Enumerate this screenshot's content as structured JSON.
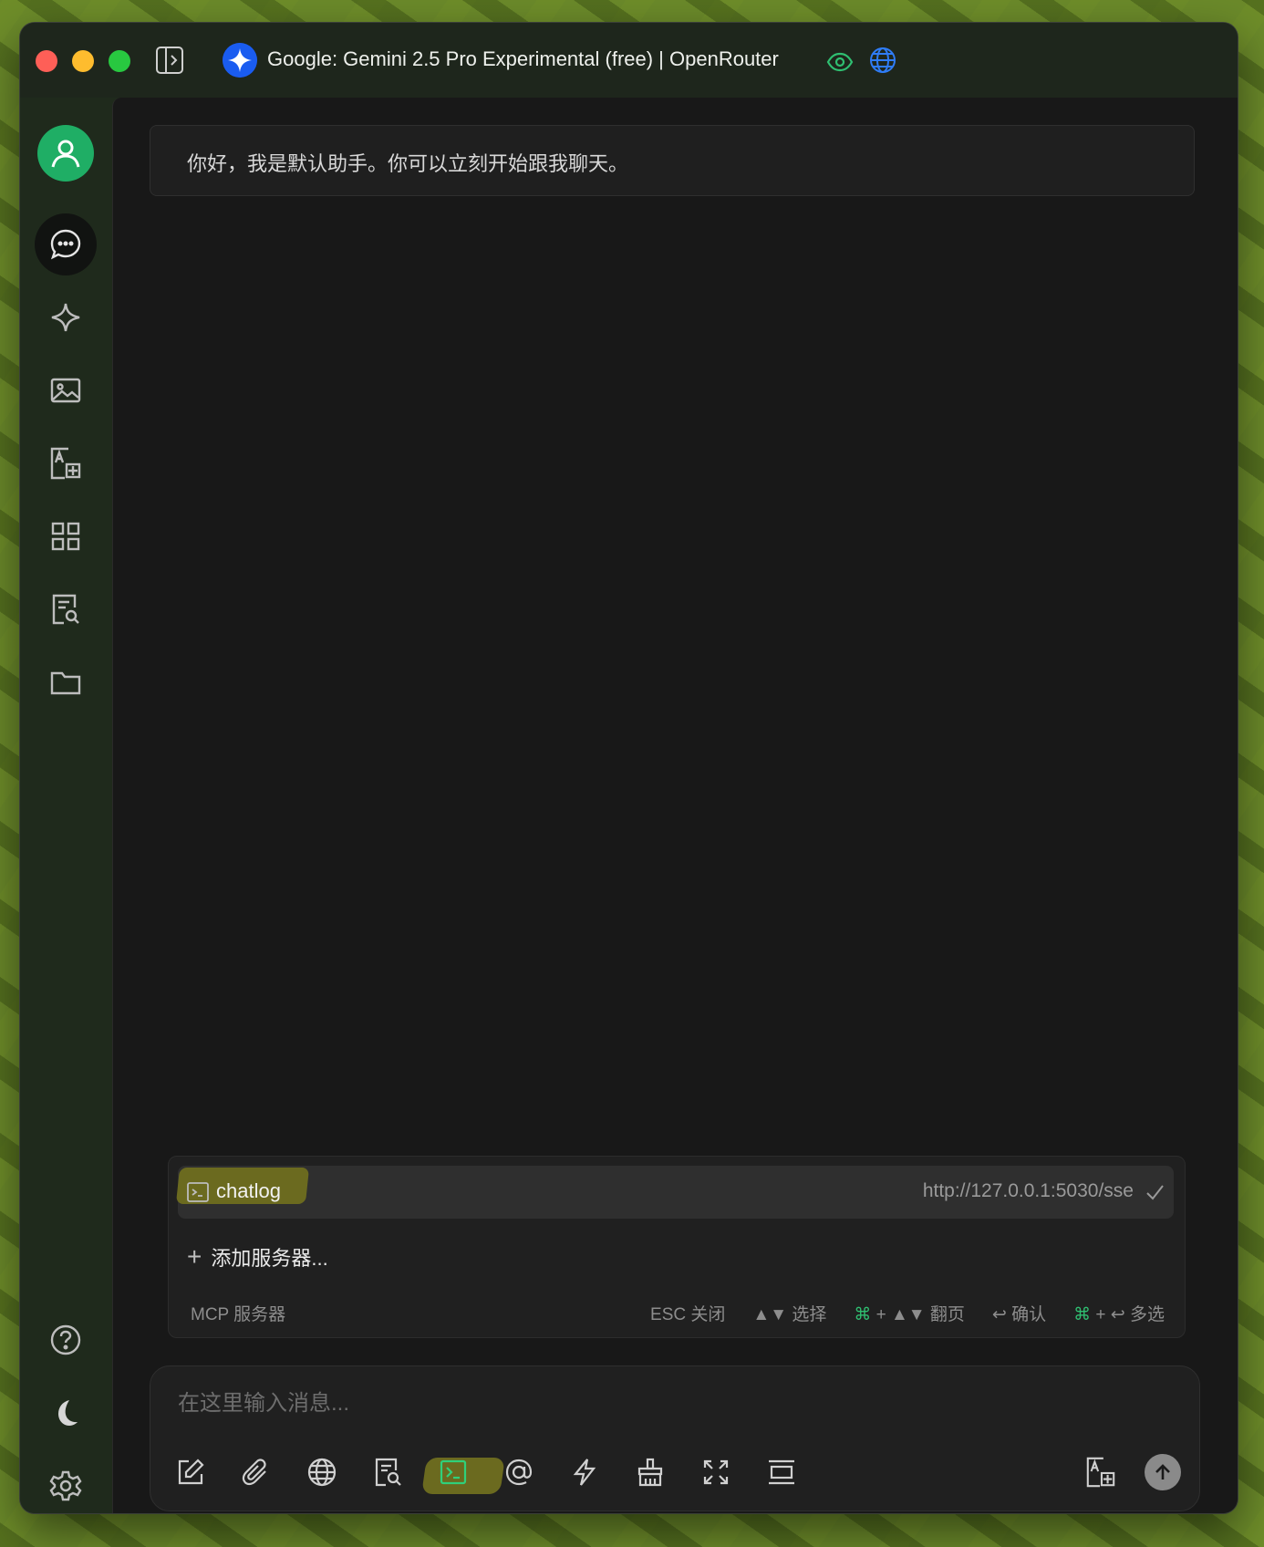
{
  "window": {
    "title": "Google: Gemini 2.5 Pro Experimental (free) | OpenRouter",
    "icons": [
      "sidebar-toggle-icon",
      "gemini-logo-icon",
      "eye-icon",
      "globe-icon"
    ],
    "accent": "#1fae65"
  },
  "sidebar": {
    "items": [
      {
        "name": "user-avatar",
        "icon": "user-icon"
      },
      {
        "name": "chat",
        "icon": "chat-bubble-icon",
        "active": true
      },
      {
        "name": "agents",
        "icon": "sparkle-icon"
      },
      {
        "name": "images",
        "icon": "image-icon"
      },
      {
        "name": "translate",
        "icon": "translate-icon"
      },
      {
        "name": "apps",
        "icon": "grid-icon"
      },
      {
        "name": "knowledge",
        "icon": "document-search-icon"
      },
      {
        "name": "files",
        "icon": "folder-icon"
      }
    ],
    "bottom": [
      {
        "name": "help",
        "icon": "help-icon"
      },
      {
        "name": "theme",
        "icon": "moon-icon"
      },
      {
        "name": "settings",
        "icon": "gear-icon"
      }
    ]
  },
  "chat": {
    "greeting": "你好，我是默认助手。你可以立刻开始跟我聊天。"
  },
  "mcp_popup": {
    "servers": [
      {
        "name": "chatlog",
        "url": "http://127.0.0.1:5030/sse",
        "selected": true
      }
    ],
    "add_label": "添加服务器...",
    "footer_label": "MCP 服务器",
    "hints": [
      {
        "key": "ESC",
        "action": "关闭"
      },
      {
        "key": "▲▼",
        "action": "选择"
      },
      {
        "key": "⌘",
        "key2": "+ ▲▼",
        "action": "翻页"
      },
      {
        "key": "↩",
        "action": "确认"
      },
      {
        "key": "⌘",
        "key2": "+ ↩",
        "action": "多选"
      }
    ]
  },
  "composer": {
    "placeholder": "在这里输入消息...",
    "tools": [
      "new-topic-icon",
      "attachment-icon",
      "web-search-icon",
      "knowledge-base-icon",
      "mcp-terminal-icon",
      "mention-icon",
      "quick-phrase-icon",
      "clear-icon",
      "expand-icon",
      "collapse-icon"
    ],
    "right_tools": [
      "translate-icon",
      "send-icon"
    ]
  }
}
